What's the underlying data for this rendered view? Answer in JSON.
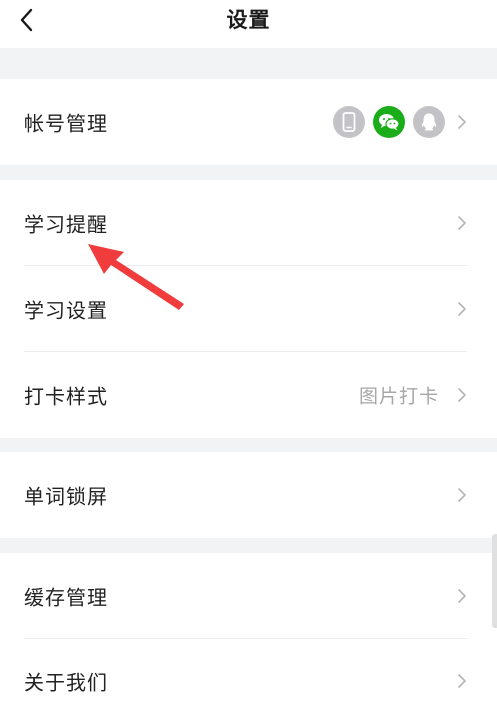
{
  "header": {
    "title": "设置"
  },
  "account": {
    "label": "帐号管理"
  },
  "study": {
    "reminder_label": "学习提醒",
    "settings_label": "学习设置",
    "checkin_label": "打卡样式",
    "checkin_value": "图片打卡"
  },
  "lockscreen": {
    "label": "单词锁屏"
  },
  "misc": {
    "cache_label": "缓存管理",
    "about_label": "关于我们"
  },
  "colors": {
    "wechat": "#1aad19",
    "inactive_icon": "#c2c2c7",
    "annotation_arrow": "#f03c3c"
  }
}
